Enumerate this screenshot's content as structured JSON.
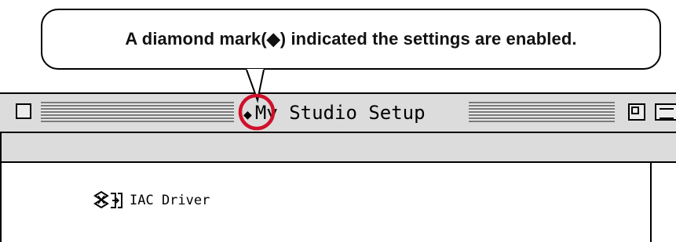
{
  "callout": {
    "text": "A diamond mark(◆) indicated the settings are enabled."
  },
  "window": {
    "title_marker": "◆",
    "title": "My Studio Setup"
  },
  "devices": [
    {
      "label": "IAC Driver",
      "icon": "midi-driver-icon"
    }
  ],
  "colors": {
    "highlight_circle": "#d0102a",
    "window_chrome": "#dcdcdc",
    "content_bg": "#ffffff"
  }
}
